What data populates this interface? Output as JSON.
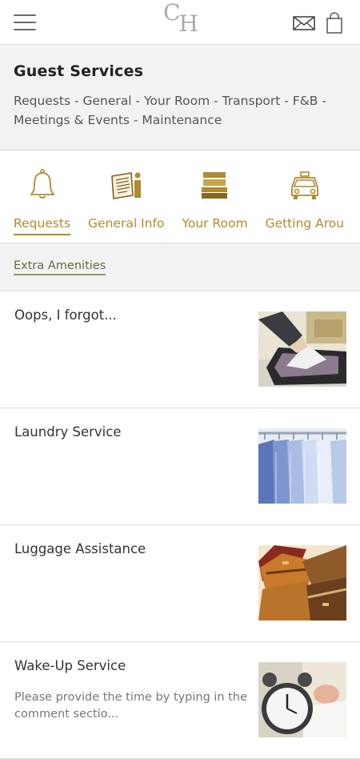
{
  "header": {
    "logo_text_first": "C",
    "logo_text_second": "H",
    "title": "Guest Services",
    "subtitle": "Requests - General - Your Room - Transport - F&B - Meetings & Events - Maintenance"
  },
  "categories": [
    {
      "label": "Requests",
      "icon": "bell-icon",
      "active": true
    },
    {
      "label": "General Info",
      "icon": "info-document-icon",
      "active": false
    },
    {
      "label": "Your Room",
      "icon": "bed-icon",
      "active": false
    },
    {
      "label": "Getting Arou",
      "icon": "taxi-icon",
      "active": false
    }
  ],
  "subcategory": {
    "label": "Extra Amenities"
  },
  "items": [
    {
      "title": "Oops, I forgot...",
      "description": "",
      "image": "packing-suitcase"
    },
    {
      "title": "Laundry Service",
      "description": "",
      "image": "hanging-shirts"
    },
    {
      "title": "Luggage Assistance",
      "description": "",
      "image": "vintage-suitcases"
    },
    {
      "title": "Wake-Up Service",
      "description": "Please provide the time by typing in the comment sectio...",
      "image": "alarm-clock"
    }
  ],
  "colors": {
    "accent": "#b08a2e",
    "sub_accent": "#5a6b44",
    "header_bg": "#f2f2f2"
  }
}
